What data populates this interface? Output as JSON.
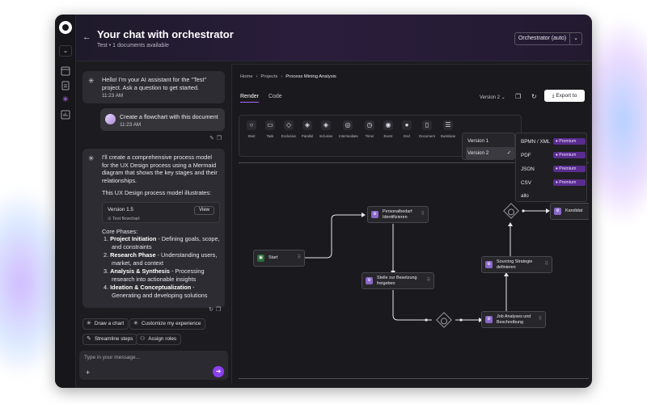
{
  "header": {
    "title": "Your chat with orchestrator",
    "subtitle": "Test • 1 documents available",
    "agent_select": "Orchestrator (auto)"
  },
  "chat": {
    "messages": [
      {
        "text": "Hello! I'm your AI assistant for the \"Test\" project. Ask a question to get started.",
        "time": "11:23 AM"
      },
      {
        "text": "Create a flowchart with this document",
        "time": "11:23 AM"
      }
    ],
    "response": {
      "intro": "I'll create a comprehensive process model for the UX Design process using a Mermaid diagram that shows the key stages and their relationships.",
      "illustrates": "This UX Design process model illustrates:",
      "card_title": "Version 1.5",
      "card_sub": "Test flowchart",
      "card_view": "View",
      "phases_title": "Core Phases:",
      "phases": [
        {
          "num": "1.",
          "name": "Project Initiation",
          "desc": " - Defining goals, scope, and constraints"
        },
        {
          "num": "2.",
          "name": "Research Phase",
          "desc": " - Understanding users, market, and context"
        },
        {
          "num": "3.",
          "name": "Analysis & Synthesis",
          "desc": " - Processing research into actionable insights"
        },
        {
          "num": "4.",
          "name": "Ideation & Conceptualization",
          "desc": " - Generating and developing solutions"
        }
      ]
    },
    "suggestions": [
      "Draw a chart",
      "Customize my experience",
      "Streamline steps",
      "Assign roles"
    ],
    "input_placeholder": "Type in your message..."
  },
  "panel": {
    "breadcrumb": [
      "Home",
      "Projects",
      "Process Mining Analysis"
    ],
    "tabs": [
      "Render",
      "Code"
    ],
    "version_label": "Version 2",
    "export_label": "Export to",
    "tools": [
      "Start",
      "Task",
      "Exclusive",
      "Parallel",
      "Inclusive",
      "Intermediate",
      "Timer",
      "Event",
      "End",
      "Document",
      "Swimlane"
    ],
    "version_menu": [
      "Version 1",
      "Version 2"
    ],
    "export_menu": [
      {
        "label": "BPMN / XML",
        "premium": "Premium"
      },
      {
        "label": "PDF",
        "premium": "Premium"
      },
      {
        "label": "JSON",
        "premium": "Premium"
      },
      {
        "label": "CSV",
        "premium": "Premium"
      },
      {
        "label": "allo",
        "premium": ""
      }
    ],
    "nodes": {
      "start": "Start",
      "personal": "Personalbedarf Identifizieren",
      "stelle": "Stelle zur Besetzung freigeben",
      "sourcing": "Sourcing Strategie definieren",
      "job": "Job Analyses und Beschreibung",
      "kandidat": "Kandidat"
    }
  }
}
